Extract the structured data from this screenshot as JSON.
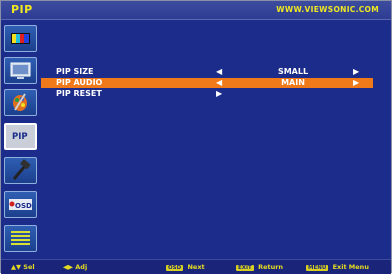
{
  "header": {
    "title": "PIP",
    "url": "WWW.VIEWSONIC.COM"
  },
  "sidebar": {
    "items": [
      {
        "icon": "color-bars-icon"
      },
      {
        "icon": "monitor-icon"
      },
      {
        "icon": "color-palette-icon"
      },
      {
        "icon": "pip-icon",
        "label": "PIP",
        "active": true
      },
      {
        "icon": "hammer-icon"
      },
      {
        "icon": "osd-icon",
        "label": "OSD"
      },
      {
        "icon": "menu-list-icon"
      }
    ]
  },
  "menu": {
    "rows": [
      {
        "label": "PIP SIZE",
        "value": "SMALL",
        "left_arrow": "◀",
        "right_arrow": "▶",
        "selected": false
      },
      {
        "label": "PIP AUDIO",
        "value": "MAIN",
        "left_arrow": "◀",
        "right_arrow": "▶",
        "selected": true
      },
      {
        "label": "PIP RESET",
        "value": "",
        "left_arrow": "",
        "right_arrow": "▶",
        "selected": false
      }
    ]
  },
  "footer": {
    "sel": {
      "key": "▲▼",
      "label": "Sel"
    },
    "adj": {
      "key": "◀▶",
      "label": "Adj"
    },
    "next": {
      "key": "OSD",
      "label": "Next"
    },
    "ret": {
      "key": "EXIT",
      "label": "Return"
    },
    "exit": {
      "key": "MENU",
      "label": "Exit Menu"
    }
  },
  "colors": {
    "background": "#1c2c8a",
    "highlight": "#f07a1a",
    "accent_text": "#f0e820"
  }
}
